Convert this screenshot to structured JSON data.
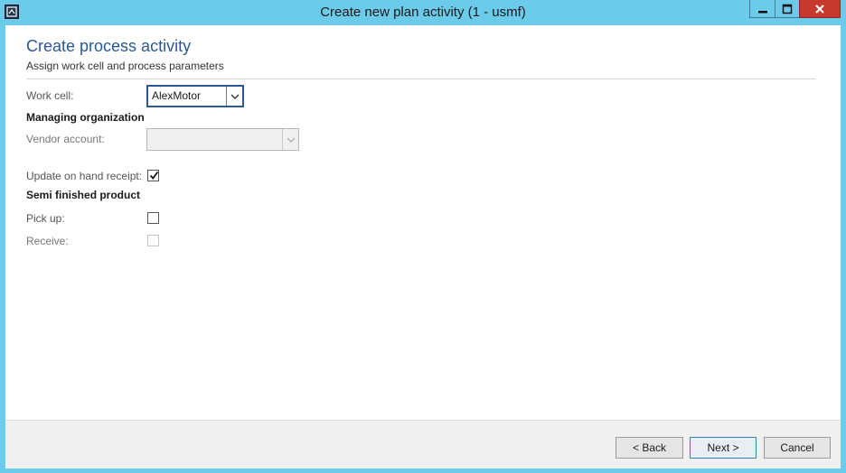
{
  "window": {
    "title": "Create new plan activity (1 - usmf)",
    "minimize_glyph": "minimize-icon",
    "maximize_glyph": "maximize-icon",
    "close_glyph": "close-icon"
  },
  "header": {
    "title": "Create process activity",
    "subtitle": "Assign work cell and process parameters"
  },
  "form": {
    "work_cell_label": "Work cell:",
    "work_cell_value": "AlexMotor",
    "managing_org_heading": "Managing organization",
    "vendor_account_label": "Vendor account:",
    "vendor_account_value": "",
    "update_on_hand_label": "Update on hand receipt:",
    "update_on_hand_checked": true,
    "semi_finished_heading": "Semi finished product",
    "pick_up_label": "Pick up:",
    "pick_up_checked": false,
    "receive_label": "Receive:",
    "receive_checked": false
  },
  "footer": {
    "back_label": "< Back",
    "next_label": "Next >",
    "cancel_label": "Cancel"
  },
  "colors": {
    "window_chrome": "#6ccbea",
    "title_accent": "#2b5797",
    "close_button": "#c7392c"
  }
}
